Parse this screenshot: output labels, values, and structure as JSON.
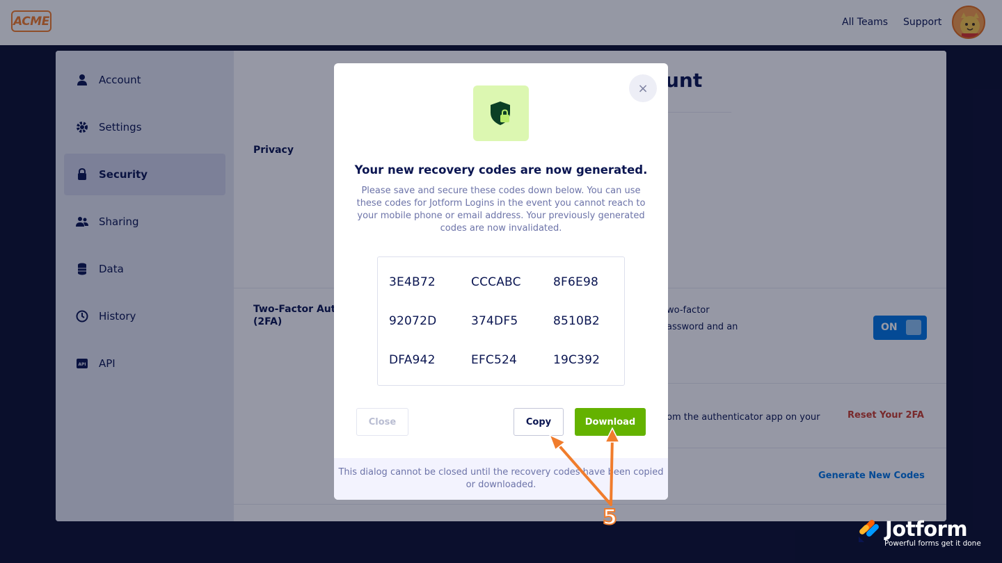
{
  "header": {
    "logo_text": "ACME",
    "nav": [
      "All Teams",
      "Support"
    ]
  },
  "sidebar": {
    "items": [
      {
        "label": "Account",
        "icon": "user-icon"
      },
      {
        "label": "Settings",
        "icon": "gear-icon"
      },
      {
        "label": "Security",
        "icon": "lock-icon",
        "active": true
      },
      {
        "label": "Sharing",
        "icon": "users-icon"
      },
      {
        "label": "Data",
        "icon": "database-icon"
      },
      {
        "label": "History",
        "icon": "history-icon"
      },
      {
        "label": "API",
        "icon": "api-icon"
      }
    ]
  },
  "content": {
    "title_fragment": "unt",
    "privacy_label": "Privacy",
    "twofa_label_line1": "Two-Factor Aut",
    "twofa_label_line2": "(2FA)",
    "twofa_text_line1": "wo-factor",
    "twofa_text_line2": "assword and an",
    "toggle_label": "ON",
    "reset_text": "om the authenticator app on your",
    "reset_link": "Reset Your 2FA",
    "generate_link": "Generate New Codes"
  },
  "modal": {
    "close_icon": "×",
    "title": "Your new recovery codes are now generated.",
    "description": "Please save and secure these codes down below. You can use these codes for Jotform Logins in the event you cannot reach to your mobile phone or email address. Your previously generated codes are now invalidated.",
    "codes": [
      [
        "3E4B72",
        "CCCABC",
        "8F6E98"
      ],
      [
        "92072D",
        "374DF5",
        "8510B2"
      ],
      [
        "DFA942",
        "EFC524",
        "19C392"
      ]
    ],
    "buttons": {
      "close": "Close",
      "copy": "Copy",
      "download": "Download"
    },
    "footer_note": "This dialog cannot be closed until the recovery codes have been copied or downloaded."
  },
  "annotation": {
    "step_number": "5"
  },
  "watermark": {
    "brand": "Jotform",
    "tagline": "Powerful forms get it done"
  },
  "colors": {
    "navy": "#0a1551",
    "download_green": "#64b200",
    "shield_bg": "#dcf7b1",
    "toggle_blue": "#0075e3",
    "reset_red": "#c83d2d",
    "arrow_orange": "#f07c2c"
  }
}
